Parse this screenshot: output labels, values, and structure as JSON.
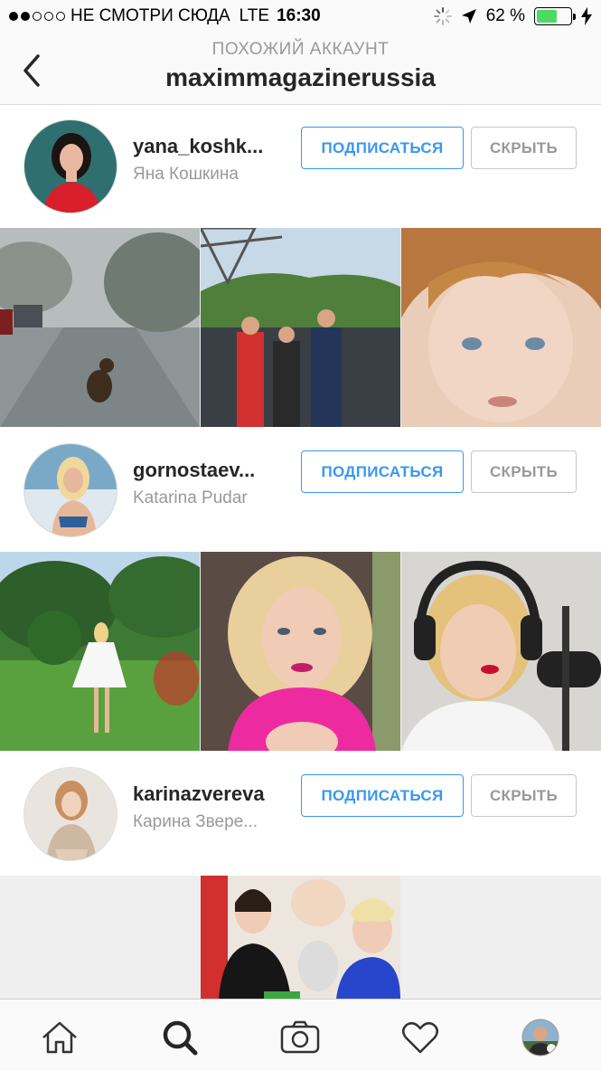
{
  "status_bar": {
    "carrier": "НЕ СМОТРИ СЮДА",
    "network": "LTE",
    "time": "16:30",
    "battery": "62 %",
    "battery_level": 0.62
  },
  "header": {
    "subtitle": "ПОХОЖИЙ АККАУНТ",
    "title": "maximmagazinerussia"
  },
  "suggestions": [
    {
      "username": "yana_koshk...",
      "full_name": "Яна Кошкина",
      "follow_label": "ПОДПИСАТЬСЯ",
      "hide_label": "СКРЫТЬ"
    },
    {
      "username": "gornostaev...",
      "full_name": "Katarina Pudar",
      "follow_label": "ПОДПИСАТЬСЯ",
      "hide_label": "СКРЫТЬ"
    },
    {
      "username": "karinazvereva",
      "full_name": "Карина Звере...",
      "follow_label": "ПОДПИСАТЬСЯ",
      "hide_label": "СКРЫТЬ"
    }
  ],
  "tabs": [
    {
      "name": "home-icon",
      "active": false
    },
    {
      "name": "search-icon",
      "active": true
    },
    {
      "name": "camera-icon",
      "active": false
    },
    {
      "name": "heart-icon",
      "active": false
    },
    {
      "name": "profile-avatar",
      "active": false
    }
  ],
  "colors": {
    "accent_blue": "#3897f0",
    "muted_gray": "#999999",
    "battery_green": "#4cd964"
  }
}
